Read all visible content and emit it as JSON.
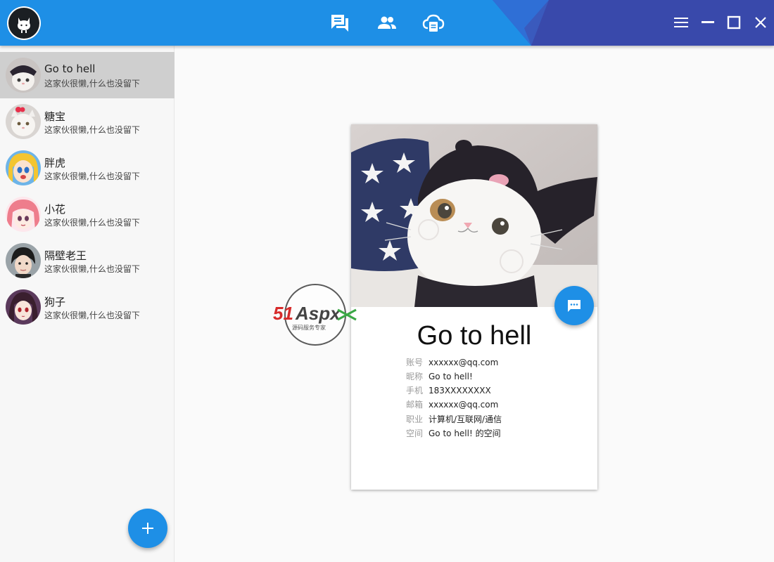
{
  "header": {
    "nav_icons": [
      "chat-icon",
      "contacts-icon",
      "cloud-icon"
    ],
    "window_buttons": [
      "menu-icon",
      "minimize-icon",
      "maximize-icon",
      "close-icon"
    ],
    "colors": {
      "primary": "#1e8fe6",
      "accent": "#3949ab"
    }
  },
  "contacts": [
    {
      "name": "Go to hell",
      "signature": "这家伙很懒,什么也没留下",
      "selected": true
    },
    {
      "name": "糖宝",
      "signature": "这家伙很懒,什么也没留下"
    },
    {
      "name": "胖虎",
      "signature": "这家伙很懒,什么也没留下"
    },
    {
      "name": "小花",
      "signature": "这家伙很懒,什么也没留下"
    },
    {
      "name": "隔壁老王",
      "signature": "这家伙很懒,什么也没留下"
    },
    {
      "name": "狗子",
      "signature": "这家伙很懒,什么也没留下"
    }
  ],
  "profile": {
    "name": "Go to hell",
    "fields": [
      {
        "label": "账号",
        "value": "xxxxxx@qq.com"
      },
      {
        "label": "昵称",
        "value": "Go to hell!"
      },
      {
        "label": "手机",
        "value": "183XXXXXXXX"
      },
      {
        "label": "邮箱",
        "value": "xxxxxx@qq.com"
      },
      {
        "label": "职业",
        "value": "计算机/互联网/通信"
      },
      {
        "label": "空间",
        "value": "Go to hell! 的空间"
      }
    ]
  },
  "watermark": {
    "brand": "51Aspx",
    "tagline": "源码服务专家"
  }
}
